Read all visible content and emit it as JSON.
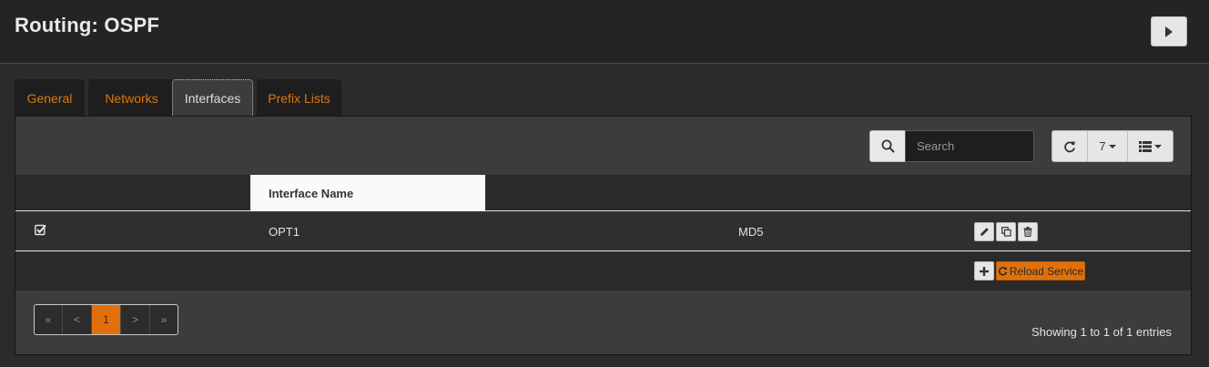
{
  "page": {
    "title": "Routing: OSPF"
  },
  "header": {
    "play_icon": "play-icon"
  },
  "tabs": [
    {
      "label": "General",
      "active": false
    },
    {
      "label": "Networks",
      "active": false
    },
    {
      "label": "Interfaces",
      "active": true
    },
    {
      "label": "Prefix Lists",
      "active": false
    }
  ],
  "toolbar": {
    "search_placeholder": "Search",
    "search_value": "",
    "rows_per_page": "7",
    "refresh_icon": "refresh-icon",
    "columns_icon": "list-columns-icon"
  },
  "table": {
    "columns": [
      "",
      "Interface Name",
      "",
      ""
    ],
    "sorted_column": "Interface Name",
    "rows": [
      {
        "enabled": true,
        "interface_name": "OPT1",
        "authentication": "MD5"
      }
    ],
    "row_actions": [
      "edit-icon",
      "copy-icon",
      "trash-icon"
    ]
  },
  "footer": {
    "add_icon": "plus-icon",
    "reload_label": "Reload Service"
  },
  "pagination": {
    "first": "«",
    "prev": "<",
    "current": "1",
    "next": ">",
    "last": "»"
  },
  "status": {
    "entries_text": "Showing 1 to 1 of 1 entries"
  },
  "colors": {
    "accent": "#e2700a",
    "background": "#2b2b2b",
    "header": "#242424",
    "panel": "#3c3c3c"
  }
}
